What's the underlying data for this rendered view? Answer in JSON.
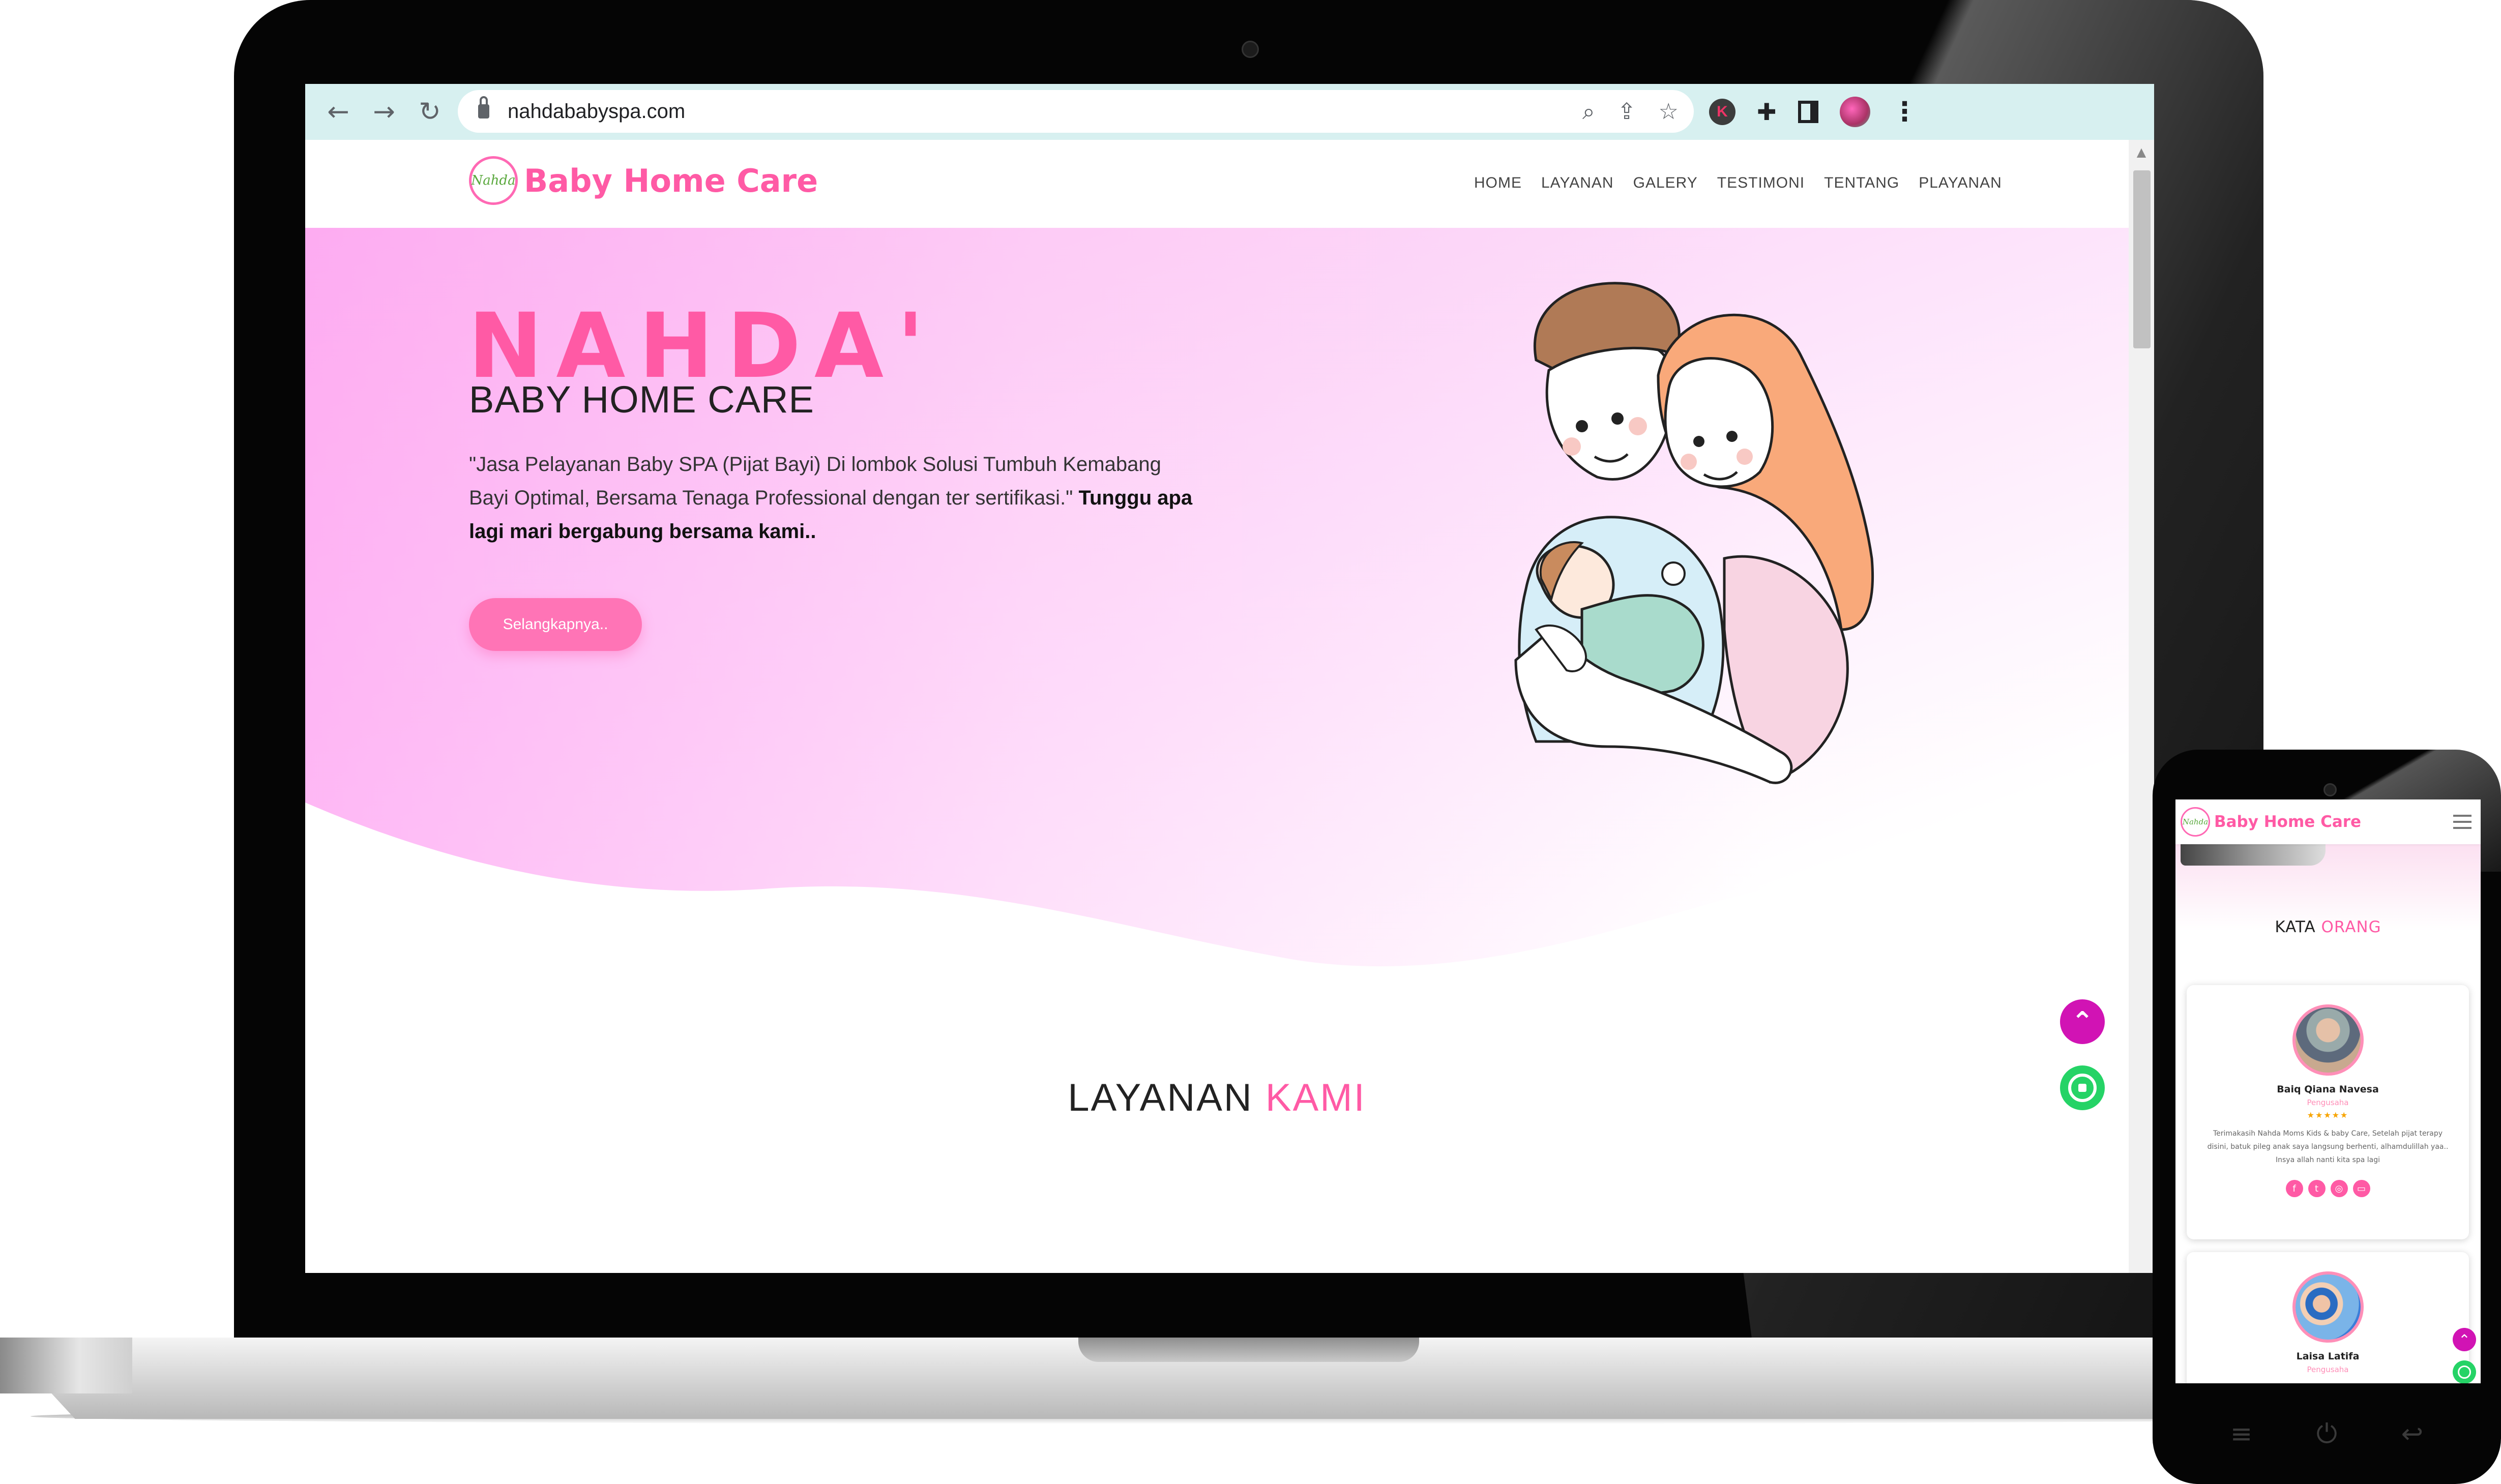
{
  "browser": {
    "url": "nahdababyspa.com",
    "nav_icons": [
      "back-arrow-icon",
      "forward-arrow-icon",
      "reload-icon"
    ],
    "omnibox_icons": [
      "zoom-icon",
      "share-icon",
      "bookmark-star-icon"
    ],
    "extension_k": "K"
  },
  "site": {
    "brand": "Baby Home Care",
    "logo_badge": "Nahda",
    "menu": [
      "HOME",
      "LAYANAN",
      "GALERY",
      "TESTIMONI",
      "TENTANG",
      "PLAYANAN"
    ],
    "hero": {
      "title": "NAHDA'",
      "subtitle": "BABY HOME CARE",
      "desc_normal": "\"Jasa Pelayanan Baby SPA (Pijat Bayi) Di lombok Solusi Tumbuh Kemabang Bayi Optimal, Bersama Tenaga Professional dengan ter sertifikasi.\" ",
      "desc_bold": "Tunggu apa lagi mari bergabung bersama kami..",
      "button": "Selangkapnya.."
    },
    "section": {
      "title_dark": "LAYANAN ",
      "title_pink": "KAMI"
    },
    "colors": {
      "brand_pink": "#ff5aa5",
      "float_up": "#d113b4",
      "whatsapp": "#25d366"
    }
  },
  "mobile": {
    "brand": "Baby Home Care",
    "logo_badge": "Nahda",
    "section": {
      "title_dark": "KATA ",
      "title_pink": "ORANG"
    },
    "testimonials": [
      {
        "name": "Baiq Qiana Navesa",
        "role": "Pengusaha",
        "stars": "★★★★★",
        "text": "Terimakasih Nahda Moms Kids & baby Care, Setelah pijat terapy disini, batuk pileg anak saya langsung berhenti, alhamdulillah yaa.. Insya allah nanti kita spa lagi",
        "socials": [
          "f",
          "t",
          "◎",
          "▭"
        ]
      },
      {
        "name": "Laisa Latifa",
        "role": "Pengusaha"
      }
    ],
    "hardware_buttons": [
      "≡",
      "⏻",
      "↩"
    ]
  }
}
